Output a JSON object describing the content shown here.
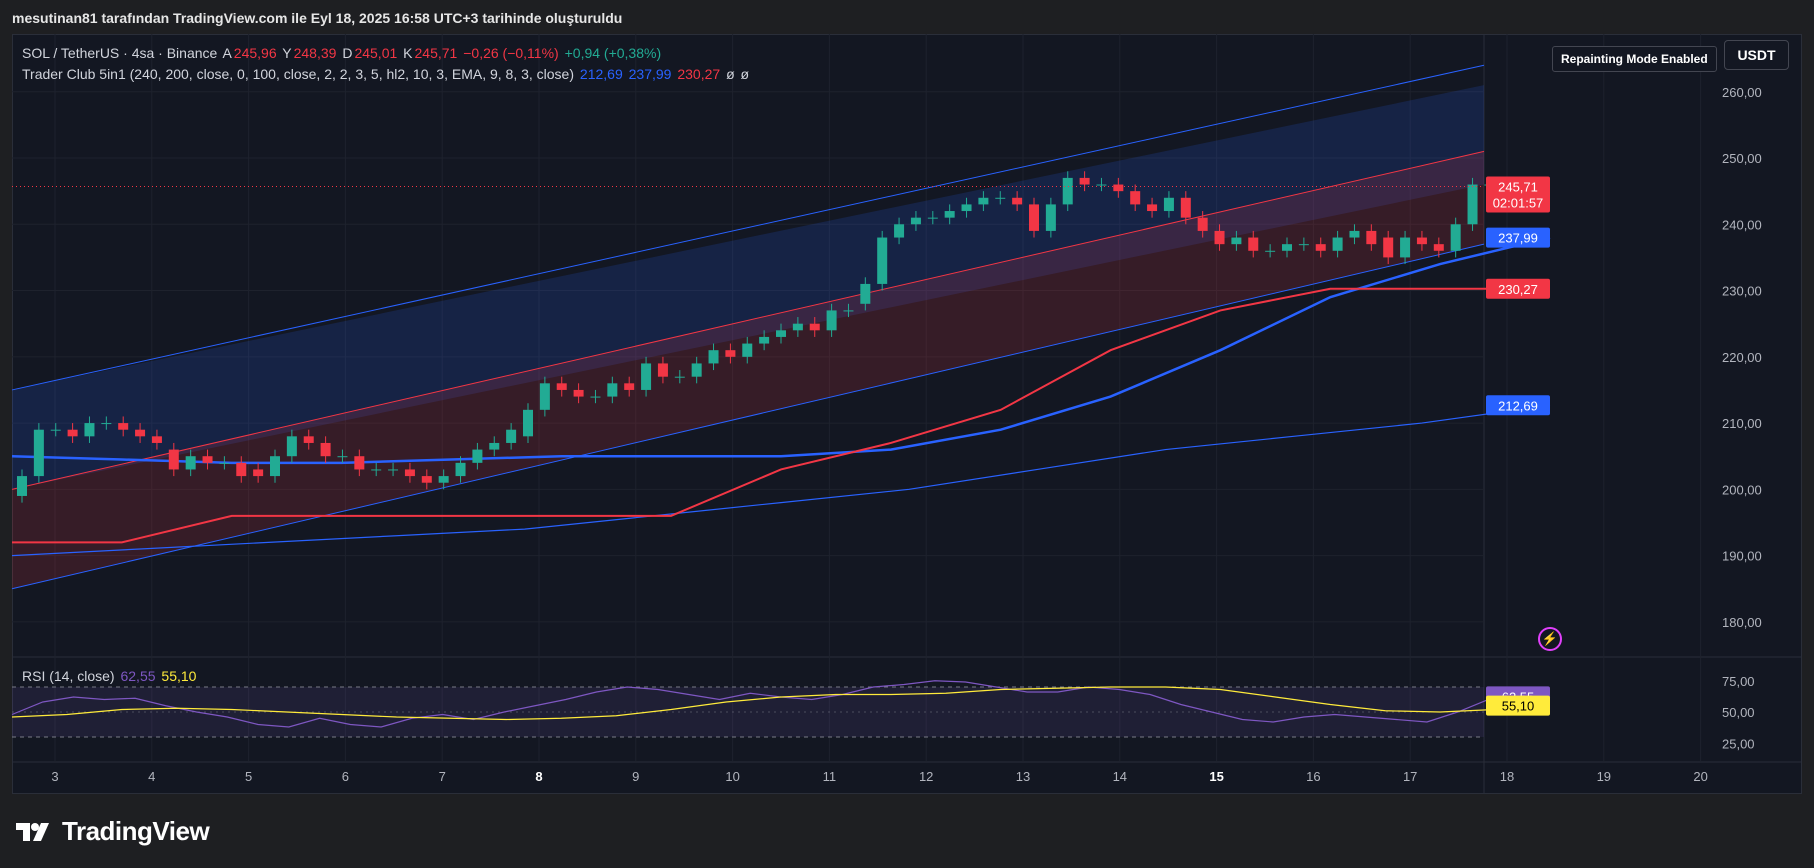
{
  "caption": "mesutinan81 tarafından TradingView.com ile Eyl 18, 2025 16:58 UTC+3 tarihinde oluşturuldu",
  "legend": {
    "symbol": "SOL / TetherUS · 4sa · Binance",
    "open_label": "A",
    "open": "245,96",
    "high_label": "Y",
    "high": "248,39",
    "low_label": "D",
    "low": "245,01",
    "close_label": "K",
    "close": "245,71",
    "change": "−0,26 (−0,11%)",
    "change2": "+0,94 (+0,38%)",
    "indicator": "Trader Club 5in1 (240, 200, close, 0, 100, close, 2, 2, 3, 5, hl2, 10, 3, EMA, 9, 8, 3, close)",
    "ind_v1": "212,69",
    "ind_v2": "237,99",
    "ind_v3": "230,27",
    "ind_v4": "ø",
    "ind_v5": "ø",
    "rsi_label": "RSI (14, close)",
    "rsi_v1": "62,55",
    "rsi_v2": "55,10"
  },
  "currency_button": "USDT",
  "repaint_badge": "Repainting Mode Enabled",
  "footer_brand": "TradingView",
  "icons": {
    "alert": "lightning-icon",
    "logo": "tradingview-logo-icon"
  },
  "colors": {
    "background": "#131722",
    "bull": "#22ab94",
    "bear": "#f23645",
    "blue_line": "#2962ff",
    "red_line": "#f23645",
    "rsi": "#7e57c2",
    "rsi_ma": "#ffeb3b"
  },
  "chart_data": {
    "type": "candlestick",
    "price_axis": {
      "min": 175,
      "max": 266,
      "ticks": [
        "260,00",
        "250,00",
        "240,00",
        "230,00",
        "220,00",
        "210,00",
        "200,00",
        "190,00",
        "180,00"
      ],
      "tick_values": [
        260,
        250,
        240,
        230,
        220,
        210,
        200,
        190,
        180
      ]
    },
    "time_axis": {
      "labels": [
        "3",
        "4",
        "5",
        "6",
        "7",
        "8",
        "9",
        "10",
        "11",
        "12",
        "13",
        "14",
        "15",
        "16",
        "17",
        "18",
        "19",
        "20"
      ],
      "bold": [
        "8",
        "15"
      ]
    },
    "price_labels": [
      {
        "text": "245,71",
        "sub": "02:01:57",
        "value": 245.71,
        "color": "#f23645"
      },
      {
        "text": "237,99",
        "value": 237.99,
        "color": "#2962ff"
      },
      {
        "text": "230,27",
        "value": 230.27,
        "color": "#f23645"
      },
      {
        "text": "212,69",
        "value": 212.69,
        "color": "#2962ff"
      }
    ],
    "candles_close": [
      202,
      209,
      209,
      208,
      210,
      210,
      209,
      208,
      207,
      203,
      205,
      204,
      204,
      202,
      202,
      205,
      208,
      207,
      205,
      205,
      203,
      203,
      203,
      202,
      201,
      202,
      204,
      206,
      207,
      209,
      212,
      216,
      215,
      214,
      214,
      216,
      215,
      219,
      217,
      217,
      219,
      221,
      220,
      222,
      223,
      224,
      225,
      224,
      227,
      227,
      231,
      238,
      240,
      241,
      241,
      242,
      243,
      244,
      244,
      243,
      239,
      243,
      247,
      246,
      246,
      245,
      243,
      242,
      244,
      241,
      239,
      237,
      238,
      236,
      236,
      237,
      237,
      236,
      238,
      239,
      237,
      235,
      238,
      237,
      236,
      240,
      246,
      246,
      245,
      245,
      245.71
    ],
    "candles_open": [
      199,
      202,
      209,
      209,
      208,
      210,
      210,
      209,
      208,
      206,
      203,
      205,
      204,
      204,
      203,
      202,
      205,
      208,
      207,
      205,
      205,
      203,
      203,
      203,
      202,
      201,
      202,
      204,
      206,
      207,
      208,
      212,
      216,
      215,
      214,
      214,
      216,
      215,
      219,
      217,
      217,
      219,
      221,
      220,
      222,
      223,
      224,
      225,
      224,
      227,
      228,
      231,
      238,
      240,
      241,
      241,
      242,
      243,
      244,
      244,
      243,
      239,
      243,
      247,
      246,
      246,
      245,
      243,
      242,
      244,
      241,
      239,
      237,
      238,
      236,
      236,
      237,
      237,
      236,
      238,
      239,
      238,
      235,
      238,
      237,
      236,
      240,
      246,
      246,
      244,
      245.96
    ],
    "rsi": {
      "ticks": [
        "75,00",
        "50,00",
        "25,00"
      ],
      "tick_values": [
        75,
        50,
        25
      ],
      "upper_band": 70,
      "lower_band": 30,
      "value": 62.55,
      "ma_value": 55.1
    },
    "series": [
      {
        "name": "212,69",
        "type": "line"
      },
      {
        "name": "237,99",
        "type": "line"
      },
      {
        "name": "230,27",
        "type": "line"
      }
    ]
  }
}
